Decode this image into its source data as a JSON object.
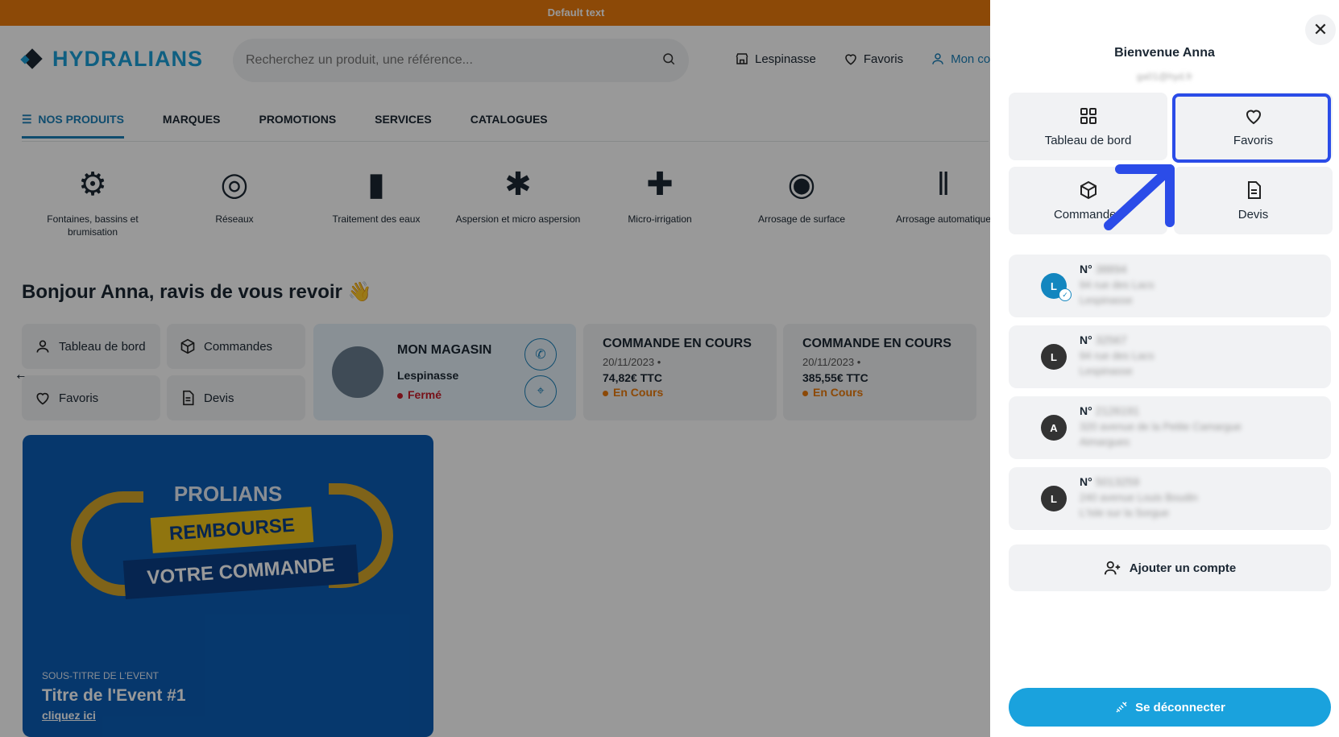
{
  "topbar": {
    "text": "Default text"
  },
  "header": {
    "logo": "HYDRALIANS",
    "search_placeholder": "Recherchez un produit, une référence...",
    "store_link": "Lespinasse",
    "favorites_link": "Favoris",
    "account_link": "Mon co"
  },
  "nav": {
    "items": [
      "NOS PRODUITS",
      "MARQUES",
      "PROMOTIONS",
      "SERVICES",
      "CATALOGUES"
    ]
  },
  "categories": [
    "Fontaines, bassins et brumisation",
    "Réseaux",
    "Traitement des eaux",
    "Aspersion et micro aspersion",
    "Micro-irrigation",
    "Arrosage de surface",
    "Arrosage automatique"
  ],
  "greeting": "Bonjour Anna, ravis de vous revoir 👋",
  "quick": {
    "dashboard": "Tableau de bord",
    "orders": "Commandes",
    "favorites": "Favoris",
    "quotes": "Devis"
  },
  "store": {
    "title": "MON MAGASIN",
    "city": "Lespinasse",
    "status": "Fermé"
  },
  "orders": [
    {
      "title": "COMMANDE EN COURS",
      "date": "20/11/2023 •",
      "price": "74,82€ TTC",
      "status": "En Cours"
    },
    {
      "title": "COMMANDE EN COURS",
      "date": "20/11/2023 •",
      "price": "385,55€ TTC",
      "status": "En Cours"
    }
  ],
  "banner": {
    "line1": "PROLIANS",
    "line2": "REMBOURSE",
    "line3": "VOTRE COMMANDE",
    "subtitle": "SOUS-TITRE DE L'EVENT",
    "title": "Titre de l'Event #1",
    "link": "cliquez ici"
  },
  "panel": {
    "welcome": "Bienvenue Anna",
    "email": "ga01@hyd.fr",
    "tiles": {
      "dashboard": "Tableau de bord",
      "favorites": "Favoris",
      "orders": "Commandes",
      "quotes": "Devis"
    },
    "accounts": [
      {
        "initial": "L",
        "num_label": "N°",
        "num": "38894",
        "line1": "94 rue des Lacs",
        "line2": "Lespinasse",
        "active": true
      },
      {
        "initial": "L",
        "num_label": "N°",
        "num": "32567",
        "line1": "94 rue des Lacs",
        "line2": "Lespinasse",
        "active": false
      },
      {
        "initial": "A",
        "num_label": "N°",
        "num": "2126191",
        "line1": "320 avenue de la Petite Camargue",
        "line2": "Aimargues",
        "active": false
      },
      {
        "initial": "L",
        "num_label": "N°",
        "num": "5013259",
        "line1": "240 avenue Louis Boudin",
        "line2": "L'Isle sur la Sorgue",
        "active": false
      }
    ],
    "add_account": "Ajouter un compte",
    "logout": "Se déconnecter"
  },
  "colors": {
    "brand": "#1a9fd8",
    "topbar": "#ea7b0c",
    "highlight": "#2b4ce8",
    "logout": "#1aa2dd"
  }
}
